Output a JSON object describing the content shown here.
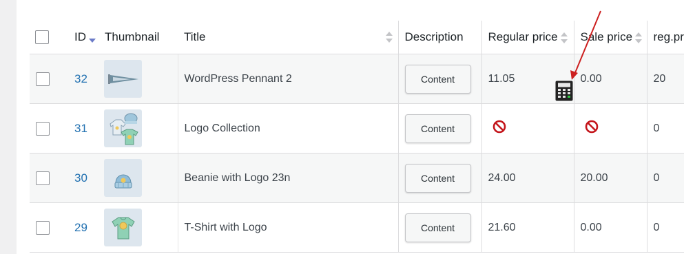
{
  "columns": {
    "id": "ID",
    "thumbnail": "Thumbnail",
    "title": "Title",
    "description": "Description",
    "regular_price": "Regular price",
    "sale_price": "Sale price",
    "reg_pr": "reg.pr"
  },
  "rows": [
    {
      "id": "32",
      "title": "WordPress Pennant 2",
      "description_button": "Content",
      "regular_price": "11.05",
      "sale_price": "0.00",
      "reg_pr": "20",
      "thumb_icon": "pennant-icon"
    },
    {
      "id": "31",
      "title": "Logo Collection",
      "description_button": "Content",
      "regular_price": "",
      "sale_price": "",
      "reg_pr": "0",
      "thumb_icon": "clothing-collection-icon"
    },
    {
      "id": "30",
      "title": "Beanie with Logo 23n",
      "description_button": "Content",
      "regular_price": "24.00",
      "sale_price": "20.00",
      "reg_pr": "0",
      "thumb_icon": "beanie-icon"
    },
    {
      "id": "29",
      "title": "T-Shirt with Logo",
      "description_button": "Content",
      "regular_price": "21.60",
      "sale_price": "0.00",
      "reg_pr": "0",
      "thumb_icon": "tshirt-icon"
    }
  ],
  "icons": {
    "not_allowed": "not-allowed-icon",
    "calculator": "calculator-icon",
    "annotation_arrow": "red-arrow"
  },
  "colors": {
    "link": "#2271b1",
    "not_allowed": "#c4161c",
    "arrow": "#cc1f1f",
    "row_alt": "#f6f7f7"
  }
}
